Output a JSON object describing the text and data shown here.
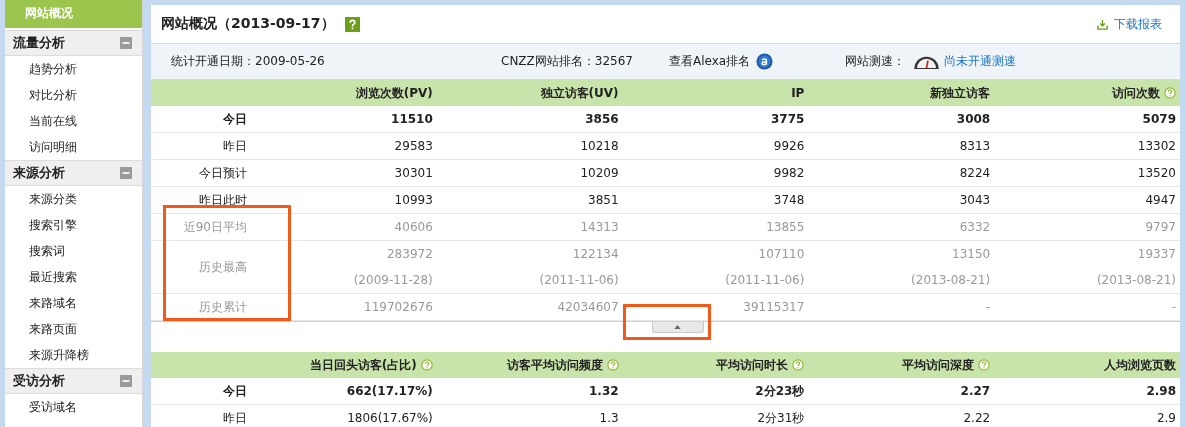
{
  "sidebar": {
    "top_item": {
      "label": "网站概况",
      "selected": true
    },
    "groups": [
      {
        "label": "流量分析",
        "expanded": true,
        "items": [
          {
            "label": "趋势分析",
            "selected": false
          },
          {
            "label": "对比分析",
            "selected": false
          },
          {
            "label": "当前在线",
            "selected": false
          },
          {
            "label": "访问明细",
            "selected": false
          }
        ]
      },
      {
        "label": "来源分析",
        "expanded": true,
        "items": [
          {
            "label": "来源分类",
            "selected": false
          },
          {
            "label": "搜索引擎",
            "selected": false
          },
          {
            "label": "搜索词",
            "selected": false
          },
          {
            "label": "最近搜索",
            "selected": false
          },
          {
            "label": "来路域名",
            "selected": false
          },
          {
            "label": "来路页面",
            "selected": false
          },
          {
            "label": "来源升降榜",
            "selected": false
          }
        ]
      },
      {
        "label": "受访分析",
        "expanded": true,
        "items": [
          {
            "label": "受访域名",
            "selected": false
          }
        ]
      }
    ]
  },
  "header": {
    "title": "网站概况（2013-09-17）",
    "download_link": "下载报表"
  },
  "info_bar": {
    "start_date": "统计开通日期：2009-05-26",
    "rank": "CNZZ网站排名：32567",
    "alexa_link": "查看Alexa排名",
    "speed_label": "网站测速：",
    "speed_link": "尚未开通测速"
  },
  "main_table": {
    "columns": [
      {
        "label": "浏览次数(PV)",
        "help": false
      },
      {
        "label": "独立访客(UV)",
        "help": false
      },
      {
        "label": "IP",
        "help": false
      },
      {
        "label": "新独立访客",
        "help": false
      },
      {
        "label": "访问次数",
        "help": true
      }
    ],
    "rows": [
      {
        "label": "今日",
        "kind": "bold",
        "cells": [
          "11510",
          "3856",
          "3775",
          "3008",
          "5079"
        ]
      },
      {
        "label": "昨日",
        "kind": "normal",
        "cells": [
          "29583",
          "10218",
          "9926",
          "8313",
          "13302"
        ]
      },
      {
        "label": "今日预计",
        "kind": "normal",
        "cells": [
          "30301",
          "10209",
          "9982",
          "8224",
          "13520"
        ]
      },
      {
        "label": "昨日此时",
        "kind": "normal",
        "cells": [
          "10993",
          "3851",
          "3748",
          "3043",
          "4947"
        ]
      },
      {
        "label": "近90日平均",
        "kind": "muted",
        "cells": [
          "40606",
          "14313",
          "13855",
          "6332",
          "9797"
        ]
      },
      {
        "label": "历史最高",
        "kind": "muted",
        "cells": [
          "283972",
          "122134",
          "107110",
          "13150",
          "19337"
        ],
        "dates": [
          "(2009-11-28)",
          "(2011-11-06)",
          "(2011-11-06)",
          "(2013-08-21)",
          "(2013-08-21)"
        ]
      },
      {
        "label": "历史累计",
        "kind": "muted",
        "cells": [
          "119702676",
          "42034607",
          "39115317",
          "-",
          "-"
        ]
      }
    ]
  },
  "second_table": {
    "columns": [
      {
        "label": "当日回头访客(占比)",
        "help": true
      },
      {
        "label": "访客平均访问频度",
        "help": true
      },
      {
        "label": "平均访问时长",
        "help": true
      },
      {
        "label": "平均访问深度",
        "help": true
      },
      {
        "label": "人均浏览页数",
        "help": false
      }
    ],
    "rows": [
      {
        "label": "今日",
        "kind": "bold",
        "cells": [
          "662(17.17%)",
          "1.32",
          "2分23秒",
          "2.27",
          "2.98"
        ]
      },
      {
        "label": "昨日",
        "kind": "normal",
        "cells": [
          "1806(17.67%)",
          "1.3",
          "2分31秒",
          "2.22",
          "2.9"
        ]
      }
    ]
  }
}
